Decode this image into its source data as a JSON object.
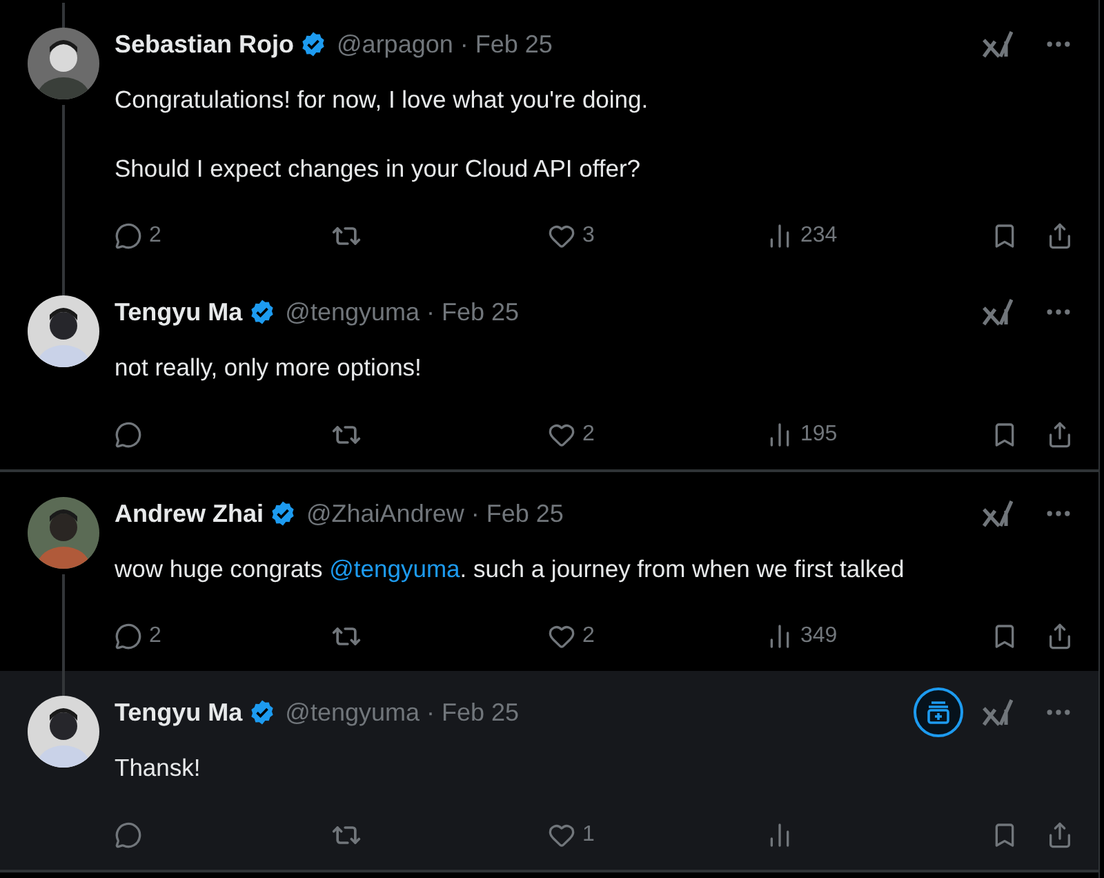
{
  "tweets": [
    {
      "name": "Sebastian Rojo",
      "verified": true,
      "handle": "@arpagon",
      "date": "· Feb 25",
      "paragraphs": [
        [
          {
            "text": "Congratulations! for now, I love what you're doing."
          }
        ],
        [
          {
            "text": "Should I expect changes in your Cloud API offer?"
          }
        ]
      ],
      "thread_above": true,
      "thread_below": true,
      "divider_after": false,
      "highlighted": false,
      "add_button": false,
      "stats": {
        "replies": "2",
        "likes": "3",
        "views": "234"
      }
    },
    {
      "name": "Tengyu Ma",
      "verified": true,
      "handle": "@tengyuma",
      "date": "· Feb 25",
      "paragraphs": [
        [
          {
            "text": "not really, only more options!"
          }
        ]
      ],
      "thread_above": true,
      "thread_below": false,
      "divider_after": true,
      "highlighted": false,
      "add_button": false,
      "stats": {
        "likes": "2",
        "views": "195"
      }
    },
    {
      "name": "Andrew Zhai",
      "verified": true,
      "handle": "@ZhaiAndrew",
      "date": "· Feb 25",
      "paragraphs": [
        [
          {
            "text": "wow huge congrats "
          },
          {
            "text": "@tengyuma",
            "kind": "mention"
          },
          {
            "text": ". such a journey from when we first talked"
          }
        ]
      ],
      "thread_above": false,
      "thread_below": true,
      "divider_after": false,
      "highlighted": false,
      "add_button": false,
      "stats": {
        "replies": "2",
        "likes": "2",
        "views": "349"
      }
    },
    {
      "name": "Tengyu Ma",
      "verified": true,
      "handle": "@tengyuma",
      "date": "· Feb 25",
      "paragraphs": [
        [
          {
            "text": "Thansk!"
          }
        ]
      ],
      "thread_above": true,
      "thread_below": false,
      "divider_after": true,
      "highlighted": true,
      "add_button": true,
      "stats": {
        "likes": "1"
      }
    }
  ]
}
